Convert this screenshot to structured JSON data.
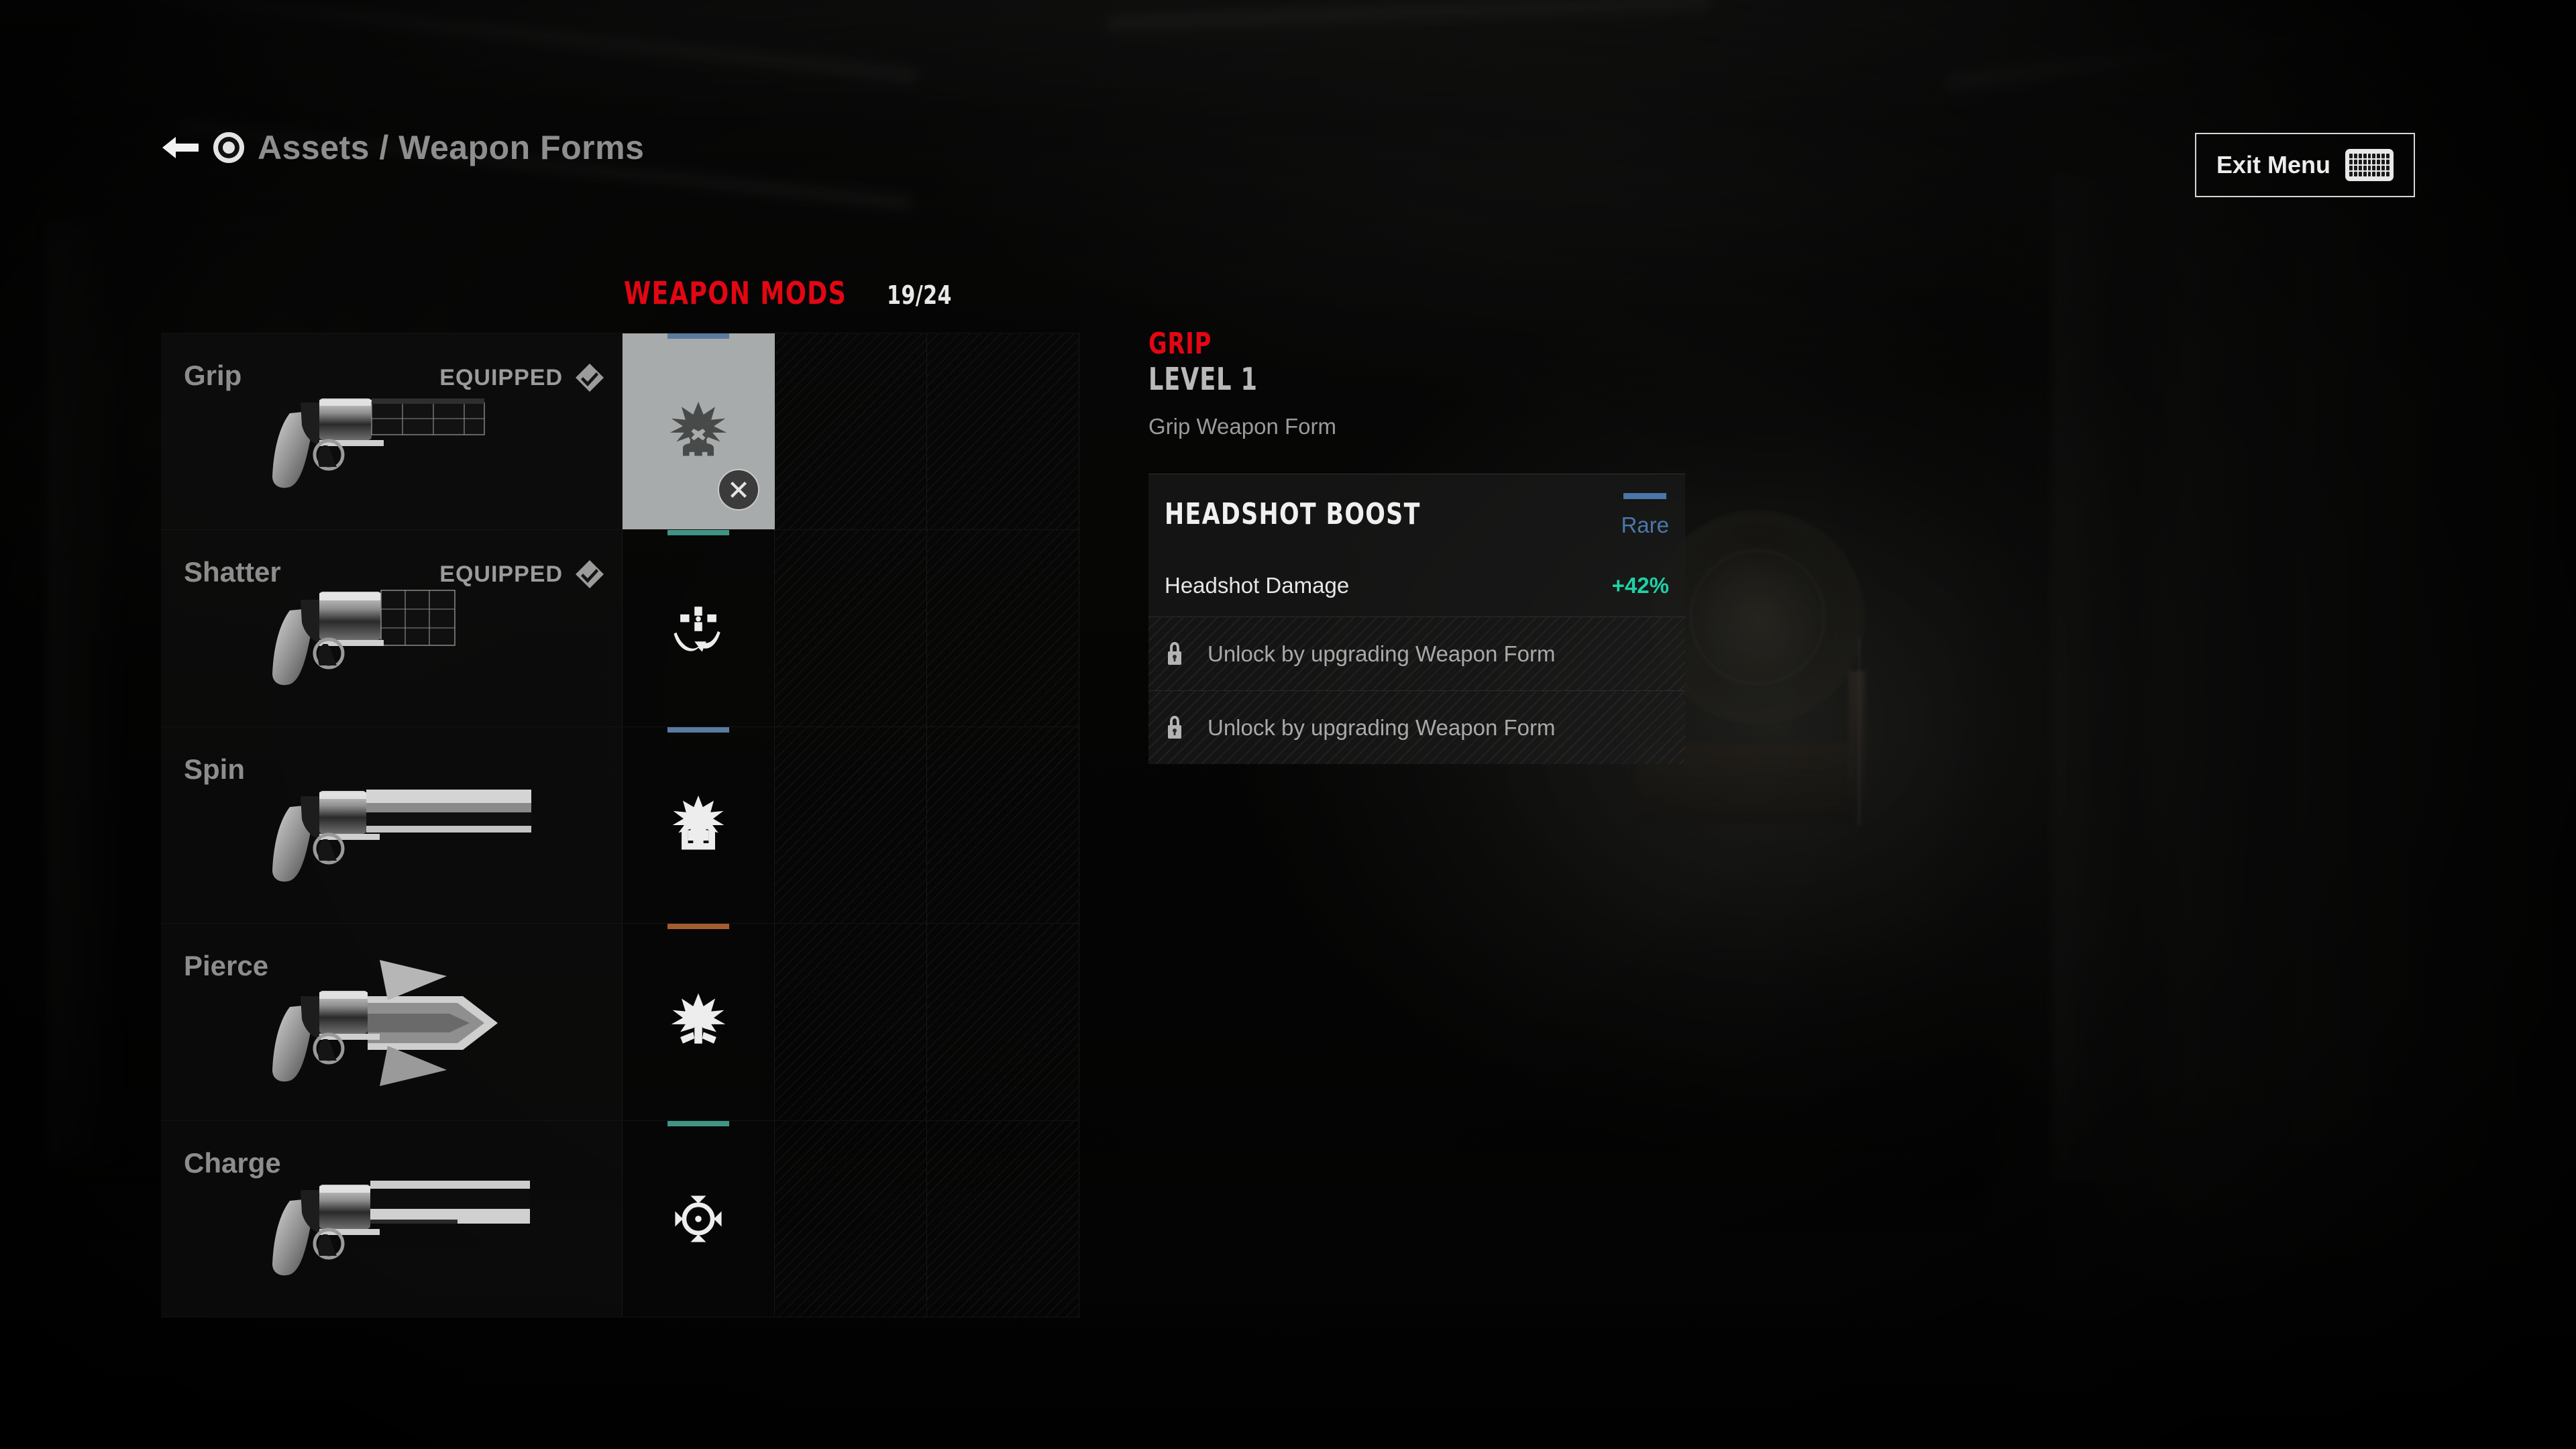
{
  "header": {
    "back_icon": "back-arrow-icon",
    "controller_icon": "circle-button-icon",
    "breadcrumb": "Assets / Weapon Forms",
    "exit_label": "Exit Menu",
    "exit_icon": "keyboard-icon"
  },
  "mods_panel": {
    "title": "WEAPON MODS",
    "count": "19/24",
    "title_color": "#e30613",
    "rows": [
      {
        "weapon": "Grip",
        "status": "EQUIPPED",
        "status_icon": "equipped-check-diamond-icon",
        "weapon_icon": "revolver-grip-icon",
        "mod": {
          "icon": "headshot-boost-icon",
          "rarity_color": "#5a7ba0",
          "selected": true,
          "remove_icon": "remove-x-icon"
        }
      },
      {
        "weapon": "Shatter",
        "status": "EQUIPPED",
        "status_icon": "equipped-check-diamond-icon",
        "weapon_icon": "revolver-shatter-icon",
        "mod": {
          "icon": "spread-control-icon",
          "rarity_color": "#3f9485",
          "selected": false,
          "remove_icon": ""
        }
      },
      {
        "weapon": "Spin",
        "status": "",
        "status_icon": "",
        "weapon_icon": "revolver-spin-icon",
        "mod": {
          "icon": "ammo-regen-icon",
          "rarity_color": "#5a7ba0",
          "selected": false,
          "remove_icon": ""
        }
      },
      {
        "weapon": "Pierce",
        "status": "",
        "status_icon": "",
        "weapon_icon": "revolver-pierce-icon",
        "mod": {
          "icon": "pierce-impact-icon",
          "rarity_color": "#a35c2e",
          "selected": false,
          "remove_icon": ""
        }
      },
      {
        "weapon": "Charge",
        "status": "",
        "status_icon": "",
        "weapon_icon": "revolver-charge-icon",
        "mod": {
          "icon": "charge-radius-icon",
          "rarity_color": "#3f9485",
          "selected": false,
          "remove_icon": ""
        }
      }
    ],
    "empty_slots_per_row": 2
  },
  "detail": {
    "title": "GRIP",
    "level": "LEVEL 1",
    "subtitle": "Grip Weapon Form",
    "mod_name": "HEADSHOT BOOST",
    "rarity": "Rare",
    "rarity_color": "#4a77a8",
    "stat_name": "Headshot Damage",
    "stat_value": "+42%",
    "stat_value_color": "#1fd1a5",
    "locked": [
      {
        "icon": "lock-icon",
        "text": "Unlock by upgrading Weapon Form"
      },
      {
        "icon": "lock-icon",
        "text": "Unlock by upgrading Weapon Form"
      }
    ]
  }
}
